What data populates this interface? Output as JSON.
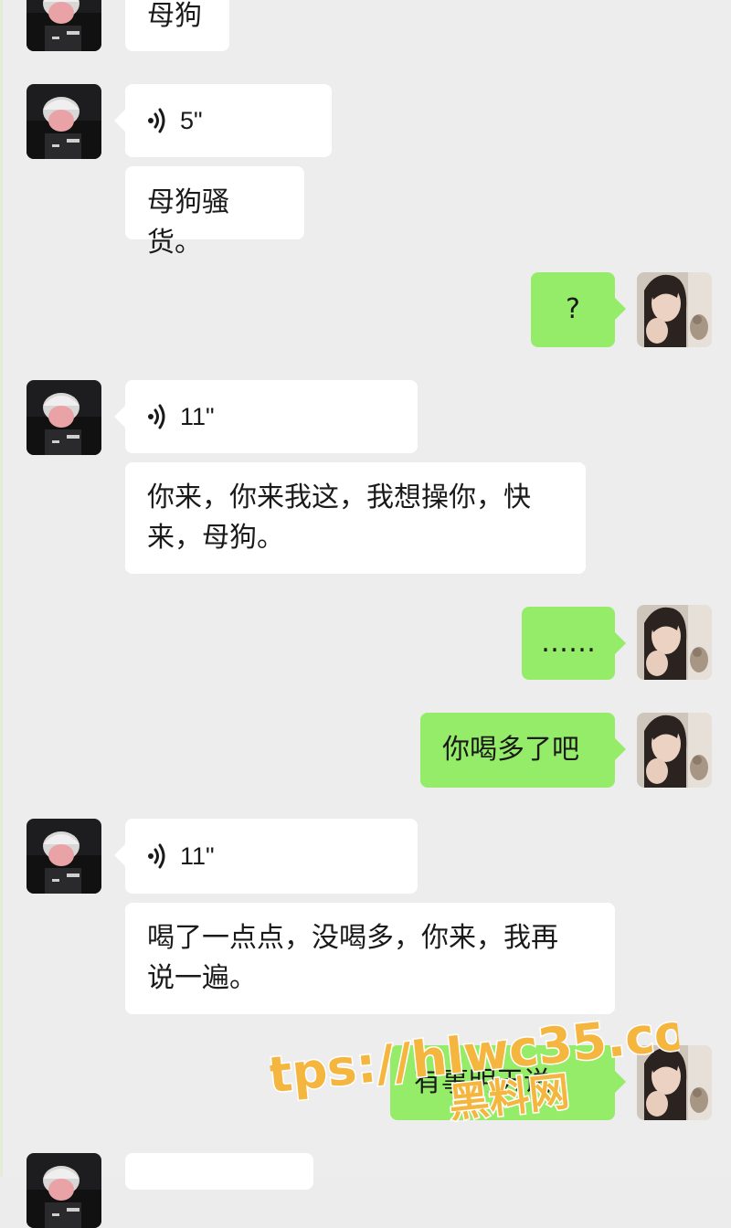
{
  "watermark": {
    "url": "https://hlwc35.com",
    "site_name": "黑料网"
  },
  "messages": [
    {
      "side": "in",
      "type": "text",
      "text": "母狗"
    },
    {
      "side": "in",
      "type": "voice",
      "duration": "5\""
    },
    {
      "side": "in",
      "type": "text",
      "text": "母狗骚货。"
    },
    {
      "side": "out",
      "type": "text",
      "text": "?"
    },
    {
      "side": "in",
      "type": "voice",
      "duration": "11\""
    },
    {
      "side": "in",
      "type": "text",
      "text": "你来，你来我这，我想操你，快\n来，母狗。"
    },
    {
      "side": "out",
      "type": "text",
      "text": "……"
    },
    {
      "side": "out",
      "type": "text",
      "text": "你喝多了吧"
    },
    {
      "side": "in",
      "type": "voice",
      "duration": "11\""
    },
    {
      "side": "in",
      "type": "text",
      "text": "喝了一点点，没喝多，你来，我再\n说一遍。"
    },
    {
      "side": "out",
      "type": "text",
      "text": "有事明天说"
    }
  ],
  "colors": {
    "background": "#ededed",
    "incoming_bubble": "#ffffff",
    "outgoing_bubble": "#95ec69",
    "watermark_fill": "#f5b640",
    "watermark_stroke": "#ffffff"
  },
  "icons": {
    "voice": "voice-wave-icon",
    "sender_avatar": "sender-avatar",
    "receiver_avatar": "receiver-avatar"
  }
}
